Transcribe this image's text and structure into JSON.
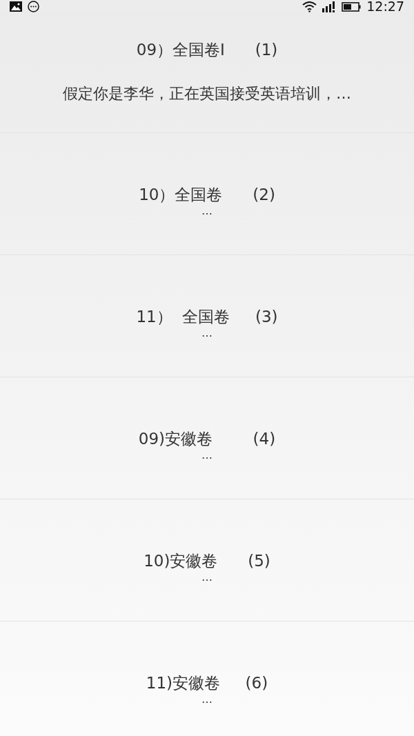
{
  "status_bar": {
    "time": "12:27"
  },
  "items": [
    {
      "title": "09）全国卷I      (1)",
      "snippet": "假定你是李华，正在英国接受英语培训，…"
    },
    {
      "title": "10）全国卷      (2)",
      "snippet": "…"
    },
    {
      "title": "11）  全国卷     (3)",
      "snippet": "…"
    },
    {
      "title": "09)安徽卷        (4)",
      "snippet": "…"
    },
    {
      "title": "10)安徽卷      (5)",
      "snippet": "…"
    },
    {
      "title": "11)安徽卷     (6)",
      "snippet": "…"
    }
  ]
}
